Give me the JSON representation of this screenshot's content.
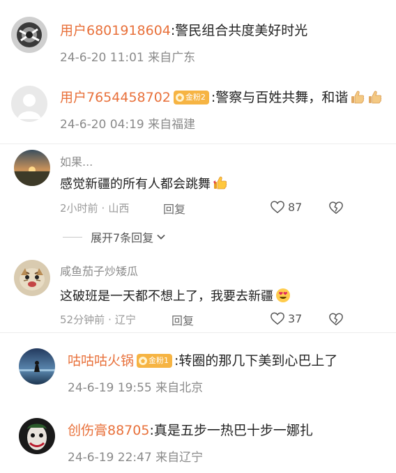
{
  "comments": [
    {
      "username": "用户6801918604",
      "text": "警民组合共度美好时光",
      "meta": "24-6-20 11:01 来自广东"
    },
    {
      "username": "用户7654458702",
      "badge": "金粉2",
      "text": "警察与百姓共舞，和谐",
      "emoji": [
        "thumbs-up-icon",
        "thumbs-up-icon"
      ],
      "meta": "24-6-20 04:19 来自福建"
    },
    {
      "username": "如果...",
      "text": "感觉新疆的所有人都会跳舞",
      "emoji": [
        "thumbs-up-icon"
      ],
      "time": "2小时前",
      "location": "山西",
      "reply_label": "回复",
      "likes": "87",
      "expand_label": "展开7条回复"
    },
    {
      "username": "咸鱼茄子炒矮瓜",
      "text": "这破班是一天都不想上了，我要去新疆",
      "emoji": [
        "heart-eyes-icon"
      ],
      "time": "52分钟前",
      "location": "辽宁",
      "reply_label": "回复",
      "likes": "37"
    },
    {
      "username": "咕咕咕火锅",
      "badge": "金粉1",
      "text": "转圈的那几下美到心巴上了",
      "meta": "24-6-19 19:55 来自北京"
    },
    {
      "username": "创伤膏88705",
      "text": "真是五步一热巴十步一娜扎",
      "meta": "24-6-19 22:47 来自辽宁"
    }
  ],
  "separator": ":",
  "dot": "·",
  "colors": {
    "username": "#e8703a",
    "badge": "#f6b443",
    "meta": "#8a8a8a"
  }
}
